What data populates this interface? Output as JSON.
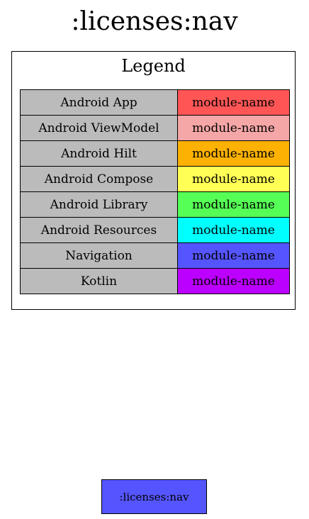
{
  "graph": {
    "title": ":licenses:nav"
  },
  "legend": {
    "title": "Legend",
    "rows": [
      {
        "type": "Android App",
        "swatch_label": "module-name",
        "color": "#ff5555"
      },
      {
        "type": "Android ViewModel",
        "swatch_label": "module-name",
        "color": "#f5a6a6"
      },
      {
        "type": "Android Hilt",
        "swatch_label": "module-name",
        "color": "#fcb103"
      },
      {
        "type": "Android Compose",
        "swatch_label": "module-name",
        "color": "#ffff55"
      },
      {
        "type": "Android Library",
        "swatch_label": "module-name",
        "color": "#55ff55"
      },
      {
        "type": "Android Resources",
        "swatch_label": "module-name",
        "color": "#00ffff"
      },
      {
        "type": "Navigation",
        "swatch_label": "module-name",
        "color": "#5555ff"
      },
      {
        "type": "Kotlin",
        "swatch_label": "module-name",
        "color": "#bb00ff"
      }
    ]
  },
  "node": {
    "label": ":licenses:nav",
    "color": "#5555ff"
  }
}
